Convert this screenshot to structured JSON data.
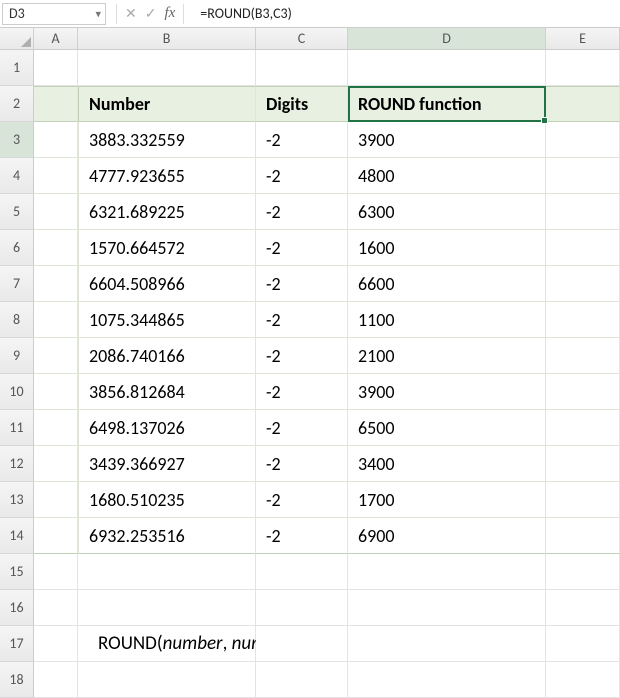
{
  "name_box": {
    "value": "D3"
  },
  "formula_bar": {
    "fx_label": "fx",
    "formula": "=ROUND(B3,C3)"
  },
  "columns": [
    "A",
    "B",
    "C",
    "D",
    "E"
  ],
  "row_numbers": [
    1,
    2,
    3,
    4,
    5,
    6,
    7,
    8,
    9,
    10,
    11,
    12,
    13,
    14,
    15,
    16,
    17,
    18
  ],
  "active_cell": {
    "row": 3,
    "col": "D"
  },
  "table": {
    "headers": {
      "number": "Number",
      "digits": "Digits",
      "result": "ROUND function"
    },
    "rows": [
      {
        "number": "3883.332559",
        "digits": "-2",
        "result": "3900"
      },
      {
        "number": "4777.923655",
        "digits": "-2",
        "result": "4800"
      },
      {
        "number": "6321.689225",
        "digits": "-2",
        "result": "6300"
      },
      {
        "number": "1570.664572",
        "digits": "-2",
        "result": "1600"
      },
      {
        "number": "6604.508966",
        "digits": "-2",
        "result": "6600"
      },
      {
        "number": "1075.344865",
        "digits": "-2",
        "result": "1100"
      },
      {
        "number": "2086.740166",
        "digits": "-2",
        "result": "2100"
      },
      {
        "number": "3856.812684",
        "digits": "-2",
        "result": "3900"
      },
      {
        "number": "6498.137026",
        "digits": "-2",
        "result": "6500"
      },
      {
        "number": "3439.366927",
        "digits": "-2",
        "result": "3400"
      },
      {
        "number": "1680.510235",
        "digits": "-2",
        "result": "1700"
      },
      {
        "number": "6932.253516",
        "digits": "-2",
        "result": "6900"
      }
    ]
  },
  "syntax": {
    "fn": "ROUND(",
    "arg1": "number",
    "sep": ", ",
    "arg2": "num_digits",
    "close": " )"
  }
}
